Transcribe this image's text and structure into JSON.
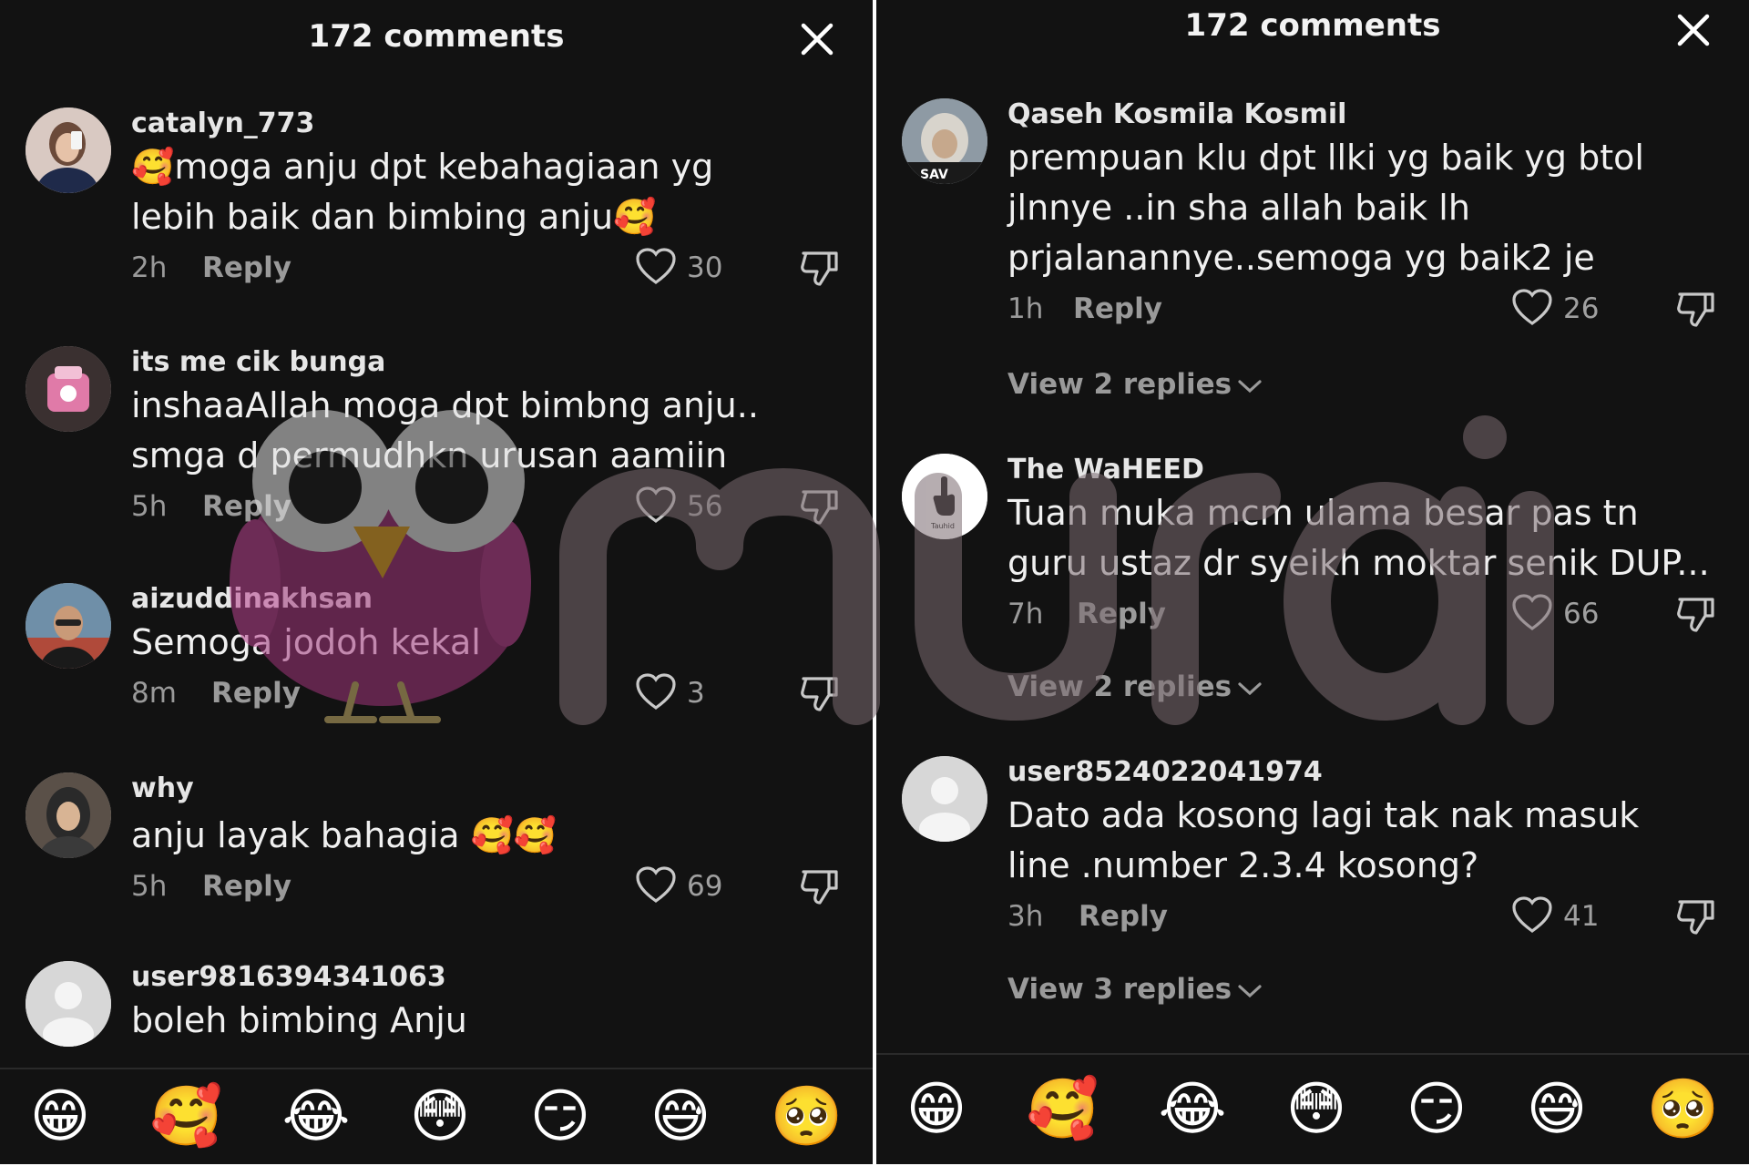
{
  "left_panel": {
    "title": "172 comments",
    "comments": [
      {
        "user": "catalyn_773",
        "text": "🥰moga anju dpt kebahagiaan yg lebih baik dan bimbing anju🥰",
        "time": "2h",
        "reply": "Reply",
        "likes": "30"
      },
      {
        "user": "its me cik bunga",
        "text": "inshaaAllah moga dpt bimbng anju.. smga d permudhkn urusan aamiin",
        "time": "5h",
        "reply": "Reply",
        "likes": "56"
      },
      {
        "user": "aizuddinakhsan",
        "text": "Semoga jodoh kekal",
        "time": "8m",
        "reply": "Reply",
        "likes": "3"
      },
      {
        "user": "why",
        "text": "anju layak bahagia 🥰🥰",
        "time": "5h",
        "reply": "Reply",
        "likes": "69"
      },
      {
        "user": "user9816394341063",
        "text": "boleh bimbing Anju"
      }
    ],
    "emojis": [
      "😁",
      "🥰",
      "😂",
      "😳",
      "😏",
      "😅",
      "🥺"
    ]
  },
  "right_panel": {
    "title": "172 comments",
    "comments": [
      {
        "user": "Qaseh Kosmila Kosmil",
        "text": "prempuan klu dpt llki yg baik yg btol jlnnye ..in sha allah baik lh prjalanannye..semoga yg baik2 je",
        "time": "1h",
        "reply": "Reply",
        "likes": "26",
        "view_replies": "View 2 replies"
      },
      {
        "user": "The WaHEED",
        "text": "Tuan muka mcm ulama besar pas tn guru ustaz dr syeikh moktar senik DUP...",
        "time": "7h",
        "reply": "Reply",
        "likes": "66",
        "view_replies": "View 2 replies"
      },
      {
        "user": "user8524022041974",
        "text": "Dato ada kosong lagi tak nak masuk line .number 2.3.4 kosong?",
        "time": "3h",
        "reply": "Reply",
        "likes": "41",
        "view_replies": "View 3 replies"
      }
    ],
    "emojis": [
      "😁",
      "🥰",
      "😂",
      "😳",
      "😏",
      "😅",
      "🥺"
    ]
  },
  "watermark": "murai",
  "avatar_badges": {
    "qaseh": "SAV",
    "waheed": "Tauhid"
  },
  "icons": {
    "close": "close-icon",
    "like": "heart-outline-icon",
    "dislike": "thumbs-down-icon",
    "chevron": "chevron-down-icon"
  }
}
